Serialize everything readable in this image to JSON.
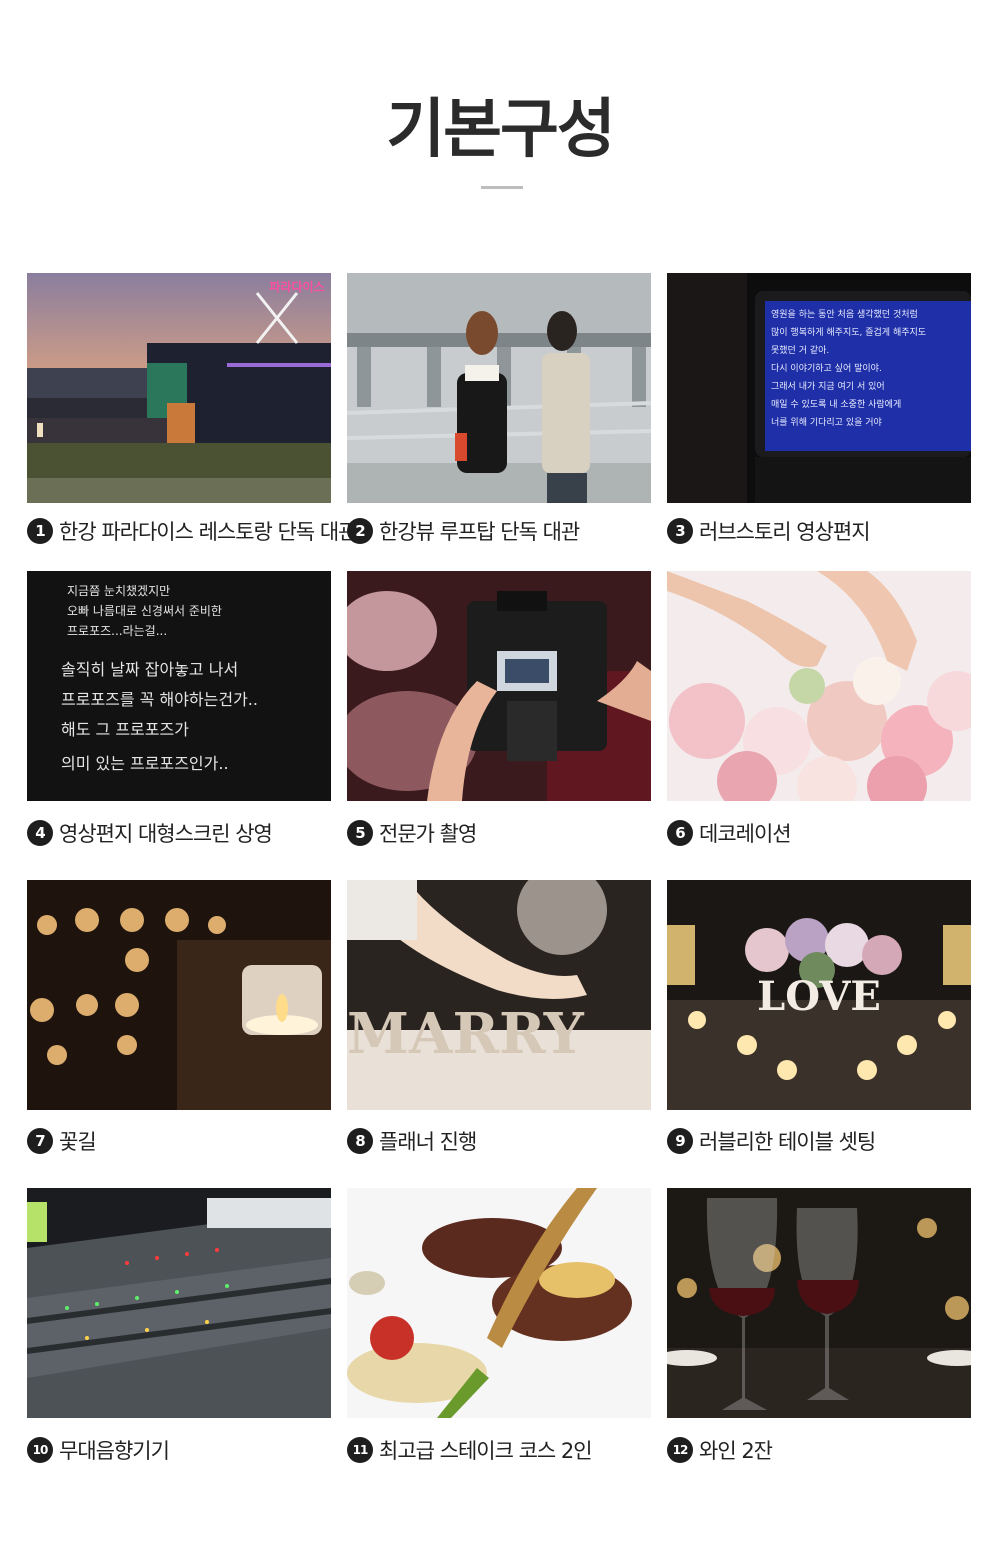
{
  "header": {
    "title": "기본구성"
  },
  "items": [
    {
      "num": "1",
      "label": "한강 파라다이스 레스토랑 단독 대관"
    },
    {
      "num": "2",
      "label": "한강뷰 루프탑 단독 대관"
    },
    {
      "num": "3",
      "label": "러브스토리 영상편지"
    },
    {
      "num": "4",
      "label": "영상편지 대형스크린 상영"
    },
    {
      "num": "5",
      "label": "전문가 촬영"
    },
    {
      "num": "6",
      "label": "데코레이션"
    },
    {
      "num": "7",
      "label": "꽃길"
    },
    {
      "num": "8",
      "label": "플래너 진행"
    },
    {
      "num": "9",
      "label": "러블리한 테이블 셋팅"
    },
    {
      "num": "10",
      "label": "무대음향기기"
    },
    {
      "num": "11",
      "label": "최고급 스테이크 코스 2인"
    },
    {
      "num": "12",
      "label": "와인 2잔"
    }
  ],
  "photo_text": {
    "sign": "파라다이스",
    "letter_lines": [
      "영원을 하는 동안 처음 생각했던 것처럼",
      "많이 행복하게 해주지도, 즐겁게 해주지도",
      "못했던 거 같아.",
      "다시 이야기하고 싶어 말이야.",
      "그래서 내가 지금 여기 서 있어",
      "매일 수 있도록 내 소중한 사람에게",
      "너를 위해 기다리고 있을 거야"
    ],
    "chalk_lines": [
      "지금쯤 눈치챘겠지만",
      "오빠 나름대로 신경써서 준비한",
      "프로포즈...라는걸...",
      "솔직히 날짜 잡아놓고 나서",
      "프로포즈를 꼭 해야하는건가..",
      "해도 그 프로포즈가",
      "의미 있는 프로포즈인가.."
    ],
    "marry": "MARRY",
    "love": "LOVE"
  }
}
